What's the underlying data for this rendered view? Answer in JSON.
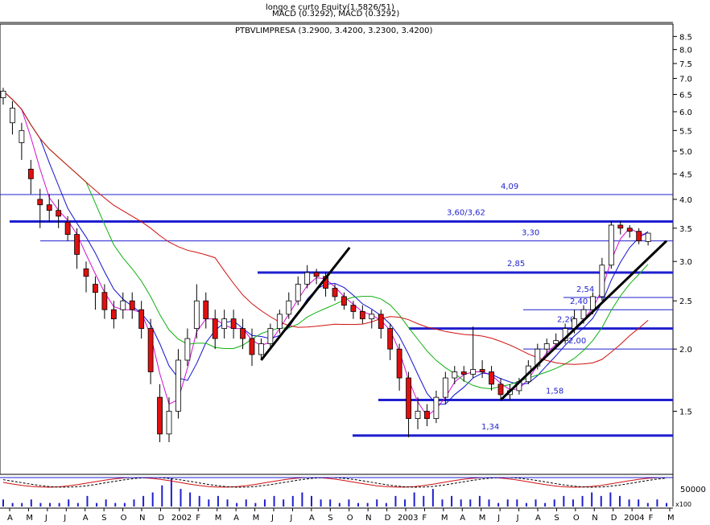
{
  "chart_data": {
    "type": "candlestick",
    "header": {
      "line1": "longo e curto Equity(1.5826/51)",
      "line2": "MACD (0.3292), MACD (0.3292)"
    },
    "title": "PTBVLIMPRESA (3.2900, 3.4200, 3.2300, 3.4200)",
    "y_scale": "log",
    "ylim": [
      1.12,
      9.0
    ],
    "y_ticks": [
      "8.5",
      "8.0",
      "7.5",
      "7.0",
      "6.5",
      "6.0",
      "5.5",
      "5.0",
      "4.5",
      "4.0",
      "3.5",
      "3.0",
      "2.5",
      "2.0",
      "1.5"
    ],
    "x_tick_labels": [
      "A",
      "M",
      "J",
      "J",
      "A",
      "S",
      "O",
      "N",
      "D",
      "2002",
      "F",
      "M",
      "A",
      "M",
      "J",
      "J",
      "A",
      "S",
      "O",
      "N",
      "D",
      "2003",
      "F",
      "M",
      "A",
      "M",
      "J",
      "J",
      "A",
      "S",
      "O",
      "N",
      "D",
      "2004",
      "F",
      "M"
    ],
    "levels": [
      {
        "label": "4,09",
        "value": 4.09,
        "style": "thin"
      },
      {
        "label": "3,60/3,62",
        "value": 3.61,
        "style": "thick"
      },
      {
        "label": "3,30",
        "value": 3.3,
        "style": "thin"
      },
      {
        "label": "2,85",
        "value": 2.85,
        "style": "thick"
      },
      {
        "label": "2,54",
        "value": 2.54,
        "style": "thin"
      },
      {
        "label": "2,40",
        "value": 2.4,
        "style": "thin"
      },
      {
        "label": "2,20",
        "value": 2.2,
        "style": "thick"
      },
      {
        "label": "2,00",
        "value": 2.0,
        "style": "thin"
      },
      {
        "label": "1,58",
        "value": 1.58,
        "style": "thick"
      },
      {
        "label": "1,34",
        "value": 1.34,
        "style": "thick"
      }
    ],
    "price_series": [
      {
        "t": 0,
        "o": 6.4,
        "c": 6.6,
        "h": 6.7,
        "l": 6.2
      },
      {
        "t": 0.5,
        "o": 5.7,
        "c": 6.1,
        "h": 6.3,
        "l": 5.4
      },
      {
        "t": 1,
        "o": 5.2,
        "c": 5.5,
        "h": 5.7,
        "l": 4.8
      },
      {
        "t": 1.5,
        "o": 4.6,
        "c": 4.4,
        "h": 4.8,
        "l": 4.1
      },
      {
        "t": 2,
        "o": 4.0,
        "c": 3.9,
        "h": 4.2,
        "l": 3.5
      },
      {
        "t": 2.5,
        "o": 3.9,
        "c": 3.8,
        "h": 4.1,
        "l": 3.6
      },
      {
        "t": 3,
        "o": 3.8,
        "c": 3.7,
        "h": 4.0,
        "l": 3.5
      },
      {
        "t": 3.5,
        "o": 3.6,
        "c": 3.4,
        "h": 3.7,
        "l": 3.3
      },
      {
        "t": 4,
        "o": 3.4,
        "c": 3.1,
        "h": 3.5,
        "l": 2.9
      },
      {
        "t": 4.5,
        "o": 2.9,
        "c": 2.8,
        "h": 3.0,
        "l": 2.6
      },
      {
        "t": 5,
        "o": 2.7,
        "c": 2.6,
        "h": 2.8,
        "l": 2.4
      },
      {
        "t": 5.5,
        "o": 2.6,
        "c": 2.4,
        "h": 2.7,
        "l": 2.3
      },
      {
        "t": 6,
        "o": 2.4,
        "c": 2.3,
        "h": 2.5,
        "l": 2.2
      },
      {
        "t": 6.5,
        "o": 2.4,
        "c": 2.5,
        "h": 2.6,
        "l": 2.3
      },
      {
        "t": 7,
        "o": 2.5,
        "c": 2.4,
        "h": 2.6,
        "l": 2.3
      },
      {
        "t": 7.5,
        "o": 2.4,
        "c": 2.2,
        "h": 2.5,
        "l": 2.1
      },
      {
        "t": 8,
        "o": 2.2,
        "c": 1.8,
        "h": 2.3,
        "l": 1.7
      },
      {
        "t": 8.5,
        "o": 1.6,
        "c": 1.35,
        "h": 1.7,
        "l": 1.3
      },
      {
        "t": 9,
        "o": 1.35,
        "c": 1.5,
        "h": 1.6,
        "l": 1.3
      },
      {
        "t": 9.5,
        "o": 1.5,
        "c": 1.9,
        "h": 2.0,
        "l": 1.45
      },
      {
        "t": 10,
        "o": 1.9,
        "c": 2.1,
        "h": 2.2,
        "l": 1.85
      },
      {
        "t": 10.5,
        "o": 2.2,
        "c": 2.5,
        "h": 2.7,
        "l": 2.1
      },
      {
        "t": 11,
        "o": 2.5,
        "c": 2.3,
        "h": 2.6,
        "l": 2.2
      },
      {
        "t": 11.5,
        "o": 2.3,
        "c": 2.1,
        "h": 2.4,
        "l": 2.0
      },
      {
        "t": 12,
        "o": 2.2,
        "c": 2.3,
        "h": 2.4,
        "l": 2.1
      },
      {
        "t": 12.5,
        "o": 2.3,
        "c": 2.2,
        "h": 2.4,
        "l": 2.1
      },
      {
        "t": 13,
        "o": 2.2,
        "c": 2.1,
        "h": 2.3,
        "l": 2.0
      },
      {
        "t": 13.5,
        "o": 2.1,
        "c": 1.95,
        "h": 2.2,
        "l": 1.85
      },
      {
        "t": 14,
        "o": 1.95,
        "c": 2.05,
        "h": 2.1,
        "l": 1.9
      },
      {
        "t": 14.5,
        "o": 2.05,
        "c": 2.2,
        "h": 2.25,
        "l": 2.0
      },
      {
        "t": 15,
        "o": 2.2,
        "c": 2.35,
        "h": 2.4,
        "l": 2.15
      },
      {
        "t": 15.5,
        "o": 2.35,
        "c": 2.5,
        "h": 2.6,
        "l": 2.3
      },
      {
        "t": 16,
        "o": 2.5,
        "c": 2.7,
        "h": 2.8,
        "l": 2.45
      },
      {
        "t": 16.5,
        "o": 2.7,
        "c": 2.85,
        "h": 2.95,
        "l": 2.65
      },
      {
        "t": 17,
        "o": 2.85,
        "c": 2.8,
        "h": 2.9,
        "l": 2.7
      },
      {
        "t": 17.5,
        "o": 2.8,
        "c": 2.65,
        "h": 2.85,
        "l": 2.55
      },
      {
        "t": 18,
        "o": 2.65,
        "c": 2.55,
        "h": 2.7,
        "l": 2.5
      },
      {
        "t": 18.5,
        "o": 2.55,
        "c": 2.45,
        "h": 2.6,
        "l": 2.4
      },
      {
        "t": 19,
        "o": 2.45,
        "c": 2.38,
        "h": 2.5,
        "l": 2.3
      },
      {
        "t": 19.5,
        "o": 2.38,
        "c": 2.3,
        "h": 2.45,
        "l": 2.25
      },
      {
        "t": 20,
        "o": 2.3,
        "c": 2.35,
        "h": 2.4,
        "l": 2.2
      },
      {
        "t": 20.5,
        "o": 2.35,
        "c": 2.2,
        "h": 2.4,
        "l": 2.1
      },
      {
        "t": 21,
        "o": 2.2,
        "c": 2.0,
        "h": 2.25,
        "l": 1.9
      },
      {
        "t": 21.5,
        "o": 2.0,
        "c": 1.75,
        "h": 2.05,
        "l": 1.65
      },
      {
        "t": 22,
        "o": 1.75,
        "c": 1.45,
        "h": 1.8,
        "l": 1.33
      },
      {
        "t": 22.5,
        "o": 1.45,
        "c": 1.5,
        "h": 1.6,
        "l": 1.38
      },
      {
        "t": 23,
        "o": 1.5,
        "c": 1.45,
        "h": 1.55,
        "l": 1.4
      },
      {
        "t": 23.5,
        "o": 1.45,
        "c": 1.6,
        "h": 1.65,
        "l": 1.42
      },
      {
        "t": 24,
        "o": 1.6,
        "c": 1.75,
        "h": 1.8,
        "l": 1.55
      },
      {
        "t": 24.5,
        "o": 1.75,
        "c": 1.8,
        "h": 1.85,
        "l": 1.7
      },
      {
        "t": 25,
        "o": 1.8,
        "c": 1.78,
        "h": 1.85,
        "l": 1.72
      },
      {
        "t": 25.5,
        "o": 1.78,
        "c": 1.82,
        "h": 2.22,
        "l": 1.75
      },
      {
        "t": 26,
        "o": 1.82,
        "c": 1.8,
        "h": 1.9,
        "l": 1.75
      },
      {
        "t": 26.5,
        "o": 1.8,
        "c": 1.7,
        "h": 1.85,
        "l": 1.65
      },
      {
        "t": 27,
        "o": 1.7,
        "c": 1.62,
        "h": 1.75,
        "l": 1.58
      },
      {
        "t": 27.5,
        "o": 1.62,
        "c": 1.65,
        "h": 1.7,
        "l": 1.58
      },
      {
        "t": 28,
        "o": 1.65,
        "c": 1.72,
        "h": 1.75,
        "l": 1.62
      },
      {
        "t": 28.5,
        "o": 1.72,
        "c": 1.85,
        "h": 1.9,
        "l": 1.7
      },
      {
        "t": 29,
        "o": 1.85,
        "c": 2.0,
        "h": 2.05,
        "l": 1.82
      },
      {
        "t": 29.5,
        "o": 2.0,
        "c": 2.05,
        "h": 2.1,
        "l": 1.95
      },
      {
        "t": 30,
        "o": 2.05,
        "c": 2.08,
        "h": 2.15,
        "l": 2.0
      },
      {
        "t": 30.5,
        "o": 2.08,
        "c": 2.2,
        "h": 2.25,
        "l": 2.05
      },
      {
        "t": 31,
        "o": 2.2,
        "c": 2.3,
        "h": 2.4,
        "l": 2.15
      },
      {
        "t": 31.5,
        "o": 2.3,
        "c": 2.4,
        "h": 2.45,
        "l": 2.25
      },
      {
        "t": 32,
        "o": 2.4,
        "c": 2.55,
        "h": 2.6,
        "l": 2.35
      },
      {
        "t": 32.5,
        "o": 2.55,
        "c": 2.95,
        "h": 3.05,
        "l": 2.5
      },
      {
        "t": 33,
        "o": 2.95,
        "c": 3.55,
        "h": 3.62,
        "l": 2.9
      },
      {
        "t": 33.5,
        "o": 3.55,
        "c": 3.5,
        "h": 3.62,
        "l": 3.4
      },
      {
        "t": 34,
        "o": 3.5,
        "c": 3.45,
        "h": 3.55,
        "l": 3.35
      },
      {
        "t": 34.5,
        "o": 3.45,
        "c": 3.3,
        "h": 3.5,
        "l": 3.25
      },
      {
        "t": 35,
        "o": 3.29,
        "c": 3.42,
        "h": 3.42,
        "l": 3.23
      }
    ],
    "volume_label": "50000",
    "volume_unit": "x100",
    "volume": [
      2,
      1,
      1,
      2,
      1,
      1,
      1,
      2,
      1,
      3,
      1,
      2,
      1,
      1,
      2,
      3,
      4,
      6,
      8,
      5,
      4,
      3,
      2,
      3,
      2,
      1,
      2,
      1,
      2,
      3,
      2,
      3,
      4,
      3,
      2,
      2,
      1,
      2,
      1,
      1,
      2,
      1,
      3,
      2,
      4,
      3,
      5,
      2,
      3,
      2,
      2,
      3,
      2,
      1,
      2,
      2,
      1,
      2,
      1,
      2,
      3,
      2,
      3,
      4,
      3,
      4,
      3,
      2,
      2,
      1,
      2,
      1
    ]
  }
}
